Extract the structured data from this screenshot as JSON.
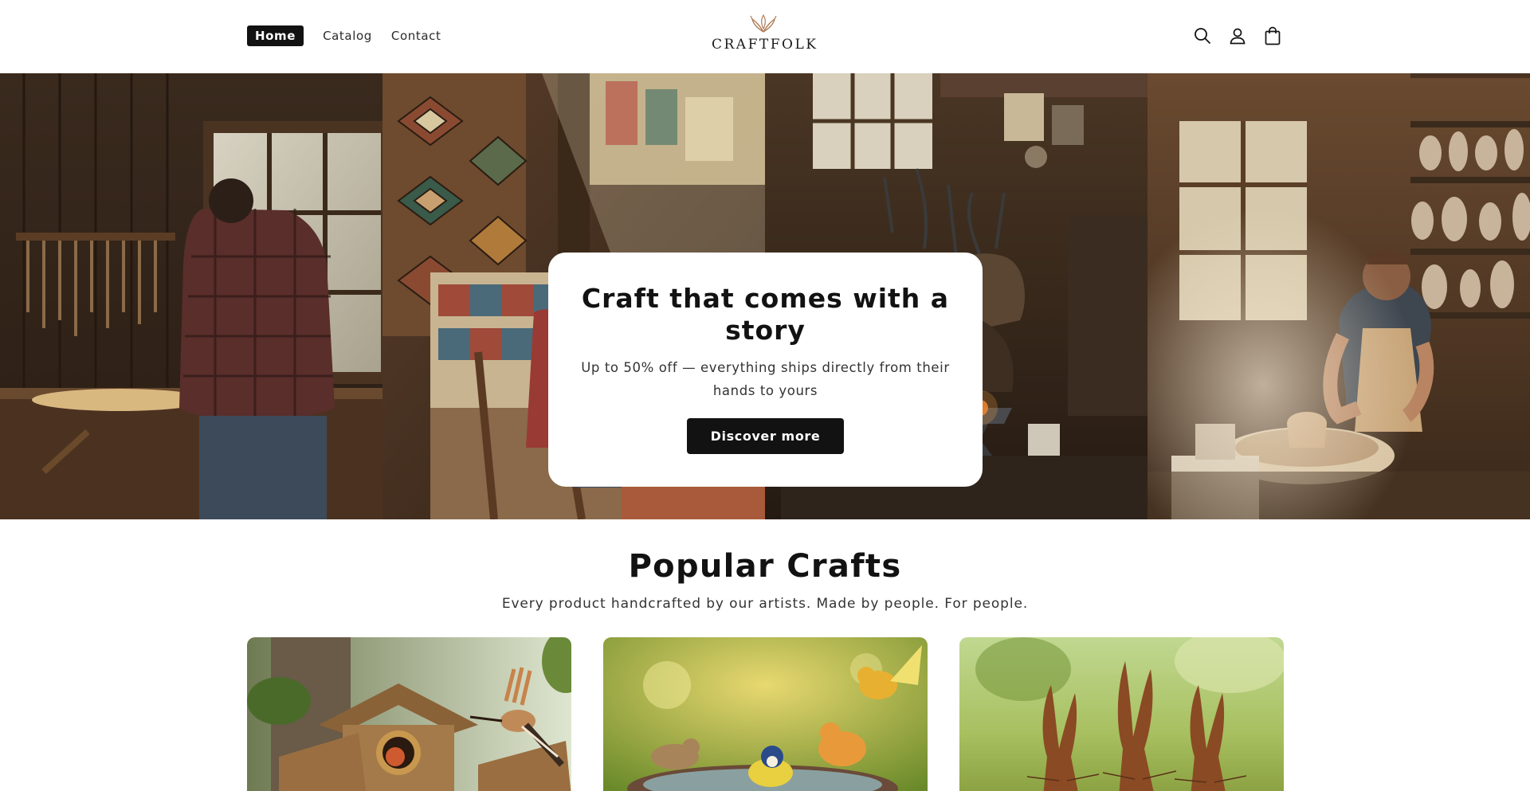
{
  "header": {
    "nav": [
      {
        "label": "Home",
        "active": true
      },
      {
        "label": "Catalog",
        "active": false
      },
      {
        "label": "Contact",
        "active": false
      }
    ],
    "logo_text": "CRAFTFOLK",
    "icons": [
      "search-icon",
      "account-icon",
      "cart-icon"
    ]
  },
  "hero": {
    "panels": [
      "woodworking workshop",
      "quilting room",
      "blacksmith forge",
      "pottery studio"
    ],
    "title": "Craft that comes with a story",
    "subtitle": "Up to 50% off — everything ships directly from their hands to yours",
    "button_label": "Discover more"
  },
  "popular": {
    "title": "Popular Crafts",
    "subtitle": "Every product handcrafted by our artists. Made by people. For people.",
    "products": [
      "wooden birdhouse with hoopoe",
      "bird bath with songbirds",
      "rusted metal rabbit figures"
    ]
  },
  "colors": {
    "text": "#121212",
    "button_bg": "#121212",
    "button_text": "#ffffff",
    "background": "#ffffff"
  }
}
